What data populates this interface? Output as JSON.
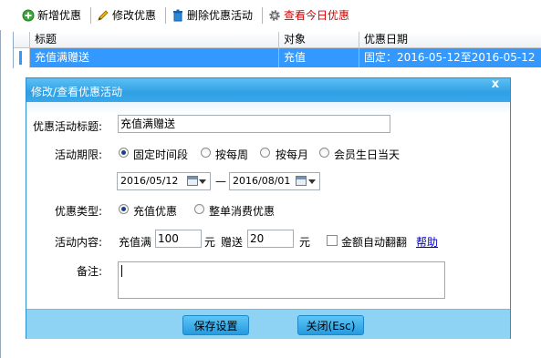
{
  "toolbar": {
    "add_label": "新增优惠",
    "edit_label": "修改优惠",
    "delete_label": "删除优惠活动",
    "today_label": "查看今日优惠"
  },
  "grid": {
    "headers": [
      "标题",
      "对象",
      "优惠日期"
    ],
    "rows": [
      {
        "title": "充值满赠送",
        "target": "充值",
        "date": "固定：2016-05-12至2016-05-12"
      }
    ]
  },
  "dialog": {
    "title": "修改/查看优惠活动",
    "close": "x",
    "title_label": "优惠活动标题:",
    "title_value": "充值满赠送",
    "period_label": "活动期限:",
    "period_options": [
      "固定时间段",
      "按每周",
      "按每月",
      "会员生日当天"
    ],
    "period_selected": "固定时间段",
    "date_from": "2016/05/12",
    "date_to": "2016/08/01",
    "date_sep": "—",
    "type_label": "优惠类型:",
    "type_options": [
      "充值优惠",
      "整单消费优惠"
    ],
    "type_selected": "充值优惠",
    "content_label": "活动内容:",
    "content_prefix": "充值满",
    "content_amount": "100",
    "content_unit1": "元",
    "content_gift_label": "赠送",
    "content_gift": "20",
    "content_unit2": "元",
    "auto_double_label": "金额自动翻翻",
    "help_label": "帮助",
    "note_label": "备注:",
    "note_value": "",
    "save_label": "保存设置",
    "close_label": "关闭(Esc)"
  },
  "colors": {
    "selection": "#3399ff",
    "dialog_title": "#2f9fe4",
    "footer": "#8ed2f4",
    "red_text": "#d40000",
    "link": "#0000cc"
  }
}
